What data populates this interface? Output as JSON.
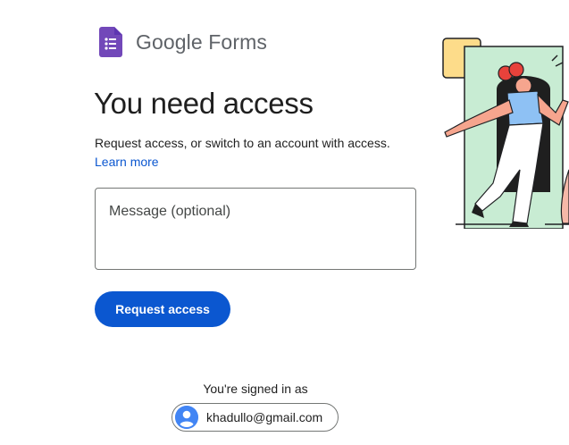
{
  "brand": {
    "logo_word_google": "Google",
    "logo_word_product": "Forms",
    "icon": "google-forms-icon",
    "icon_color": "#7248b9"
  },
  "main": {
    "title": "You need access",
    "description": "Request access, or switch to an account with access.",
    "learn_more": "Learn more"
  },
  "message_field": {
    "placeholder": "Message (optional)",
    "value": ""
  },
  "request_button": {
    "label": "Request access",
    "color": "#0b57d0"
  },
  "account": {
    "signed_in_label": "You're signed in as",
    "email": "khadullo@gmail.com",
    "avatar_icon": "person-avatar-icon",
    "avatar_color": "#4285f4"
  },
  "illustration": {
    "icon": "person-walking-through-door-illustration"
  }
}
